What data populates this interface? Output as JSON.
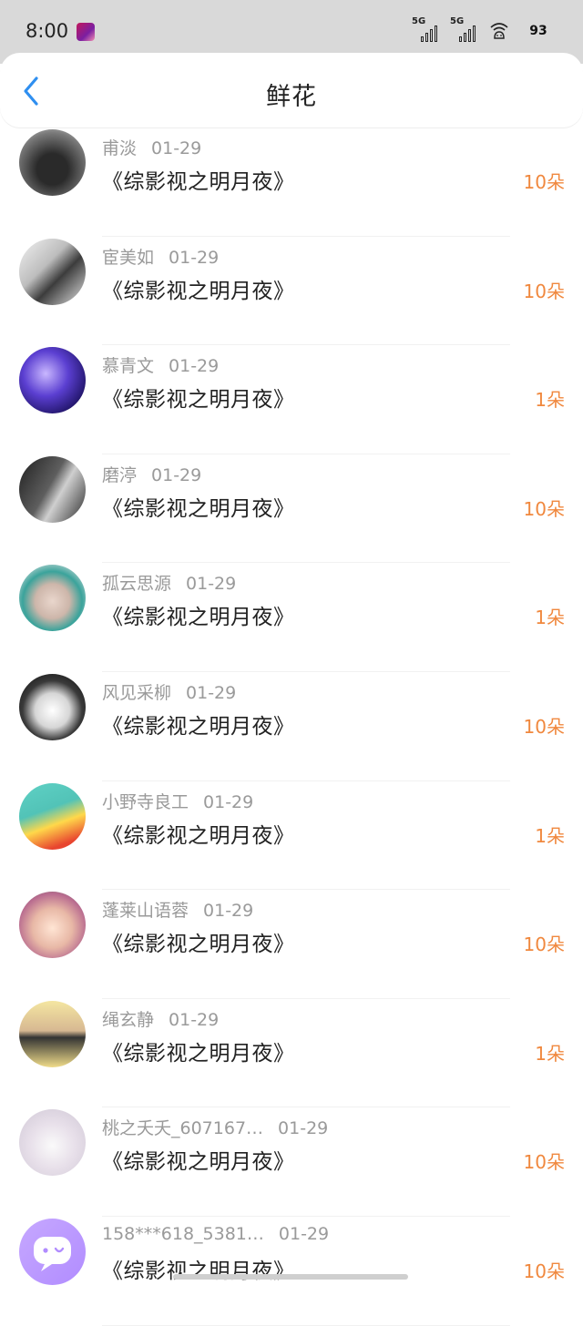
{
  "status_bar": {
    "time": "8:00",
    "signal_1_label": "5G",
    "signal_2_label": "5G",
    "battery": "93"
  },
  "header": {
    "title": "鲜花",
    "back_icon": "chevron-left-icon"
  },
  "colors": {
    "accent_blue": "#2f8ff0",
    "count_orange": "#f0883e",
    "secondary_text": "#9a9a9a"
  },
  "records": [
    {
      "user": "甫淡",
      "date": "01-29",
      "book": "《综影视之明月夜》",
      "count": "10朵",
      "avatar": "dark-car-photo"
    },
    {
      "user": "宦美如",
      "date": "01-29",
      "book": "《综影视之明月夜》",
      "count": "10朵",
      "avatar": "bw-portrait-photo"
    },
    {
      "user": "慕青文",
      "date": "01-29",
      "book": "《综影视之明月夜》",
      "count": "1朵",
      "avatar": "purple-lights-photo"
    },
    {
      "user": "磨渟",
      "date": "01-29",
      "book": "《综影视之明月夜》",
      "count": "10朵",
      "avatar": "bw-couple-photo"
    },
    {
      "user": "孤云思源",
      "date": "01-29",
      "book": "《综影视之明月夜》",
      "count": "1朵",
      "avatar": "teal-hair-woman-photo"
    },
    {
      "user": "风见采柳",
      "date": "01-29",
      "book": "《综影视之明月夜》",
      "count": "10朵",
      "avatar": "husky-with-glasses-photo"
    },
    {
      "user": "小野寺良工",
      "date": "01-29",
      "book": "《综影视之明月夜》",
      "count": "1朵",
      "avatar": "cartoon-yellow-photo"
    },
    {
      "user": "蓬莱山语蓉",
      "date": "01-29",
      "book": "《综影视之明月夜》",
      "count": "10朵",
      "avatar": "child-with-flowers-photo"
    },
    {
      "user": "绳玄静",
      "date": "01-29",
      "book": "《综影视之明月夜》",
      "count": "1朵",
      "avatar": "girl-with-caption-photo"
    },
    {
      "user": "桃之夭夭_607167…",
      "date": "01-29",
      "book": "《综影视之明月夜》",
      "count": "10朵",
      "avatar": "cat-doodle-photo"
    },
    {
      "user": "158***618_5381…",
      "date": "01-29",
      "book": "《综影视之明月夜》",
      "count": "10朵",
      "avatar": "default-chat-avatar"
    }
  ]
}
